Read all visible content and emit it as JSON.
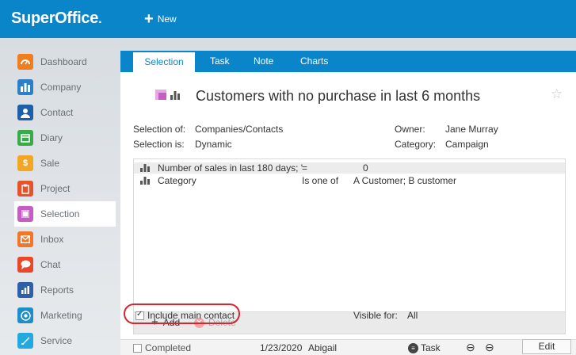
{
  "app": {
    "logo": "SuperOffice",
    "logo_dot": ".",
    "new_label": "New"
  },
  "sidebar": {
    "items": [
      {
        "label": "Dashboard",
        "icon": "dashboard-icon",
        "color": "#f07d1e"
      },
      {
        "label": "Company",
        "icon": "company-icon",
        "color": "#2a7fc6"
      },
      {
        "label": "Contact",
        "icon": "contact-icon",
        "color": "#1f5fa8"
      },
      {
        "label": "Diary",
        "icon": "diary-icon",
        "color": "#39a94c"
      },
      {
        "label": "Sale",
        "icon": "sale-icon",
        "color": "#f2a623"
      },
      {
        "label": "Project",
        "icon": "project-icon",
        "color": "#e5532c"
      },
      {
        "label": "Selection",
        "icon": "selection-icon",
        "color": "#c55ec2"
      },
      {
        "label": "Inbox",
        "icon": "inbox-icon",
        "color": "#f0772a"
      },
      {
        "label": "Chat",
        "icon": "chat-icon",
        "color": "#e8472a"
      },
      {
        "label": "Reports",
        "icon": "reports-icon",
        "color": "#2f5fa6"
      },
      {
        "label": "Marketing",
        "icon": "marketing-icon",
        "color": "#1e8ec9"
      },
      {
        "label": "Service",
        "icon": "service-icon",
        "color": "#22a9e0"
      }
    ],
    "active": "Selection"
  },
  "tabs": [
    "Selection",
    "Task",
    "Note",
    "Charts"
  ],
  "selection": {
    "title": "Customers with no purchase in last 6 months",
    "selection_of_label": "Selection of:",
    "selection_of_value": "Companies/Contacts",
    "selection_is_label": "Selection is:",
    "selection_is_value": "Dynamic",
    "owner_label": "Owner:",
    "owner_value": "Jane Murray",
    "category_label": "Category:",
    "category_value": "Campaign"
  },
  "criteria": {
    "rows": [
      {
        "field": "Number of sales in last 180 days; '",
        "operator": "=",
        "value": "0"
      },
      {
        "field": "Category",
        "operator": "Is one of",
        "value": "A Customer; B customer"
      }
    ],
    "add_label": "Add",
    "delete_label": "Delete"
  },
  "options": {
    "include_main_contact_label": "Include main contact",
    "include_main_contact_checked": true,
    "visible_for_label": "Visible for:",
    "visible_for_value": "All"
  },
  "footer": {
    "completed_label": "Completed",
    "date": "1/23/2020",
    "user": "Abigail",
    "task_label": "Task",
    "edit_label": "Edit"
  },
  "colors": {
    "brand": "#0b85c9",
    "highlight": "#d6262f"
  }
}
